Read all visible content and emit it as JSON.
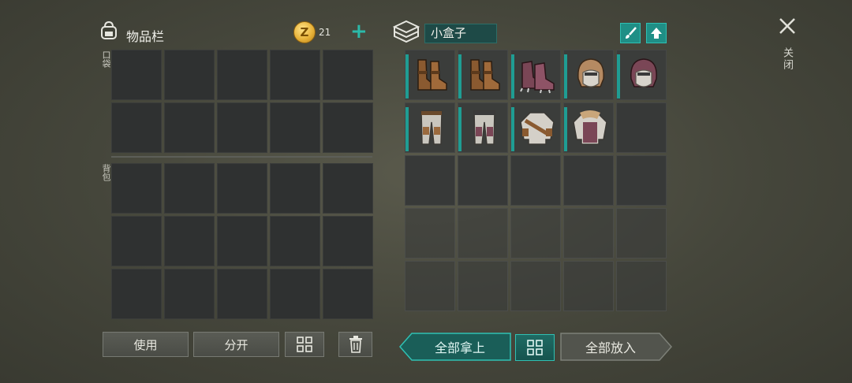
{
  "inventory": {
    "title": "物品栏",
    "pocket_label": "口袋",
    "backpack_label": "背包",
    "coins": "21",
    "coin_symbol": "Z"
  },
  "box": {
    "name": "小盒子",
    "items": [
      {
        "slot": 0,
        "icon": "leather-boots-icon"
      },
      {
        "slot": 1,
        "icon": "leather-boots-icon"
      },
      {
        "slot": 2,
        "icon": "spiked-boots-icon"
      },
      {
        "slot": 3,
        "icon": "leather-hood-icon"
      },
      {
        "slot": 4,
        "icon": "purple-hood-icon"
      },
      {
        "slot": 5,
        "icon": "leather-pants-icon"
      },
      {
        "slot": 6,
        "icon": "purple-pants-icon"
      },
      {
        "slot": 7,
        "icon": "leather-jacket-icon"
      },
      {
        "slot": 8,
        "icon": "purple-jacket-icon"
      }
    ]
  },
  "header": {
    "close_label": "关闭"
  },
  "buttons": {
    "use": "使用",
    "split": "分开",
    "take_all": "全部拿上",
    "put_all": "全部放入"
  },
  "colors": {
    "accent": "#2bb9a9",
    "slot": "#2f3131",
    "coin": "#e8b33a"
  }
}
